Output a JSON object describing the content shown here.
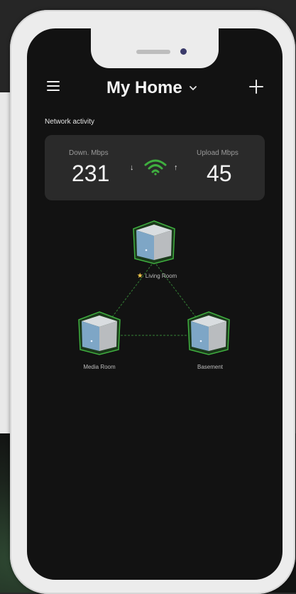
{
  "header": {
    "title": "My Home",
    "chevron_icon": "chevron-down-icon",
    "menu_icon": "hamburger-menu-icon",
    "add_icon": "plus-icon"
  },
  "activity": {
    "section_label": "Network activity",
    "download_label": "Down. Mbps",
    "download_value": "231",
    "upload_label": "Upload Mbps",
    "upload_value": "45",
    "down_arrow": "↓",
    "up_arrow": "↑",
    "wifi_color": "#3fae3f"
  },
  "nodes": [
    {
      "label": "Living Room",
      "primary": true
    },
    {
      "label": "Media Room",
      "primary": false
    },
    {
      "label": "Basement",
      "primary": false
    }
  ],
  "colors": {
    "accent_green": "#3fae3f",
    "screen_bg": "#121212",
    "card_bg": "#2a2a2a"
  }
}
